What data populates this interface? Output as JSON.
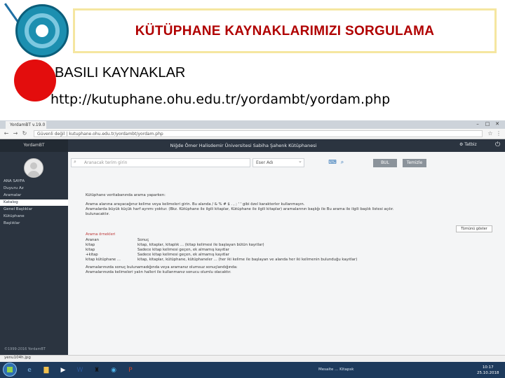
{
  "slide": {
    "title": "KÜTÜPHANE KAYNAKLARIMIZI SORGULAMA",
    "subtitle": "BASILI KAYNAKLAR",
    "url": "http://kutuphane.ohu.edu.tr/yordambt/yordam.php",
    "colors": {
      "title": "#b00000",
      "dot": "#e30d0d",
      "box": "#f5e6a0"
    }
  },
  "browser": {
    "tab_label": "YordamBT v.19.0",
    "address": "Güvenli değil | kutuphane.ohu.edu.tr/yordambt/yordam.php",
    "app_brand": "YordamBT",
    "app_title": "Niğde Ömer Halisdemir Üniversitesi Sabiha Şahenk Kütüphanesi",
    "settings_label": "Tatbiz",
    "sidebar": [
      "ANA SAYFA",
      "Duyuru Az",
      "Aramalar",
      "Katalog",
      "Genel Başlıklar",
      "Kütüphane",
      "Başlıklar"
    ],
    "copyright": "©1999-2016 YordamBT",
    "search": {
      "placeholder": "Aranacak terim girin",
      "field": "Eser Adı",
      "find_button": "BUL",
      "clear_button": "Temizle"
    },
    "help_lines": [
      "Kütüphane veritabanında arama yaparken:",
      "Arama alanına arayacağınız kelime veya kelimeleri girin. Bu alanda / & % # $ . , ; ' ' gibi özel karakterler kullanmayın.",
      "Aramalarda büyük küçük harf ayrımı yoktur. (Bkz. Kütüphane ile ilgili kitaplar, Kütüphane ile ilgili kitaplar) aramalarının başlığı ile Bu arama ile ilgili başlık listesi açılır.",
      "bulunacaktır."
    ],
    "examples_title": "Arama örnekleri",
    "examples": [
      {
        "term": "Aranan",
        "result": "Sonuç"
      },
      {
        "term": "kitap",
        "result": "kitap, kitaplar, kitaplık ... (kitap kelimesi ile başlayan bütün kayıtlar)"
      },
      {
        "term": "kitap",
        "result": "Sadece kitap kelimesi geçen, ek almamış kayıtlar"
      },
      {
        "term": "+kitap",
        "result": "Sadece kitap kelimesi geçen, ek almamış kayıtlar"
      },
      {
        "term": "kitap kütüphane ...",
        "result": "kitap, kitaplar, kütüphane, kütüphaneler ... (her iki kelime ile başlayan ve alanda her iki kelimenin bulunduğu kayıtlar)"
      }
    ],
    "footer_lines": [
      "Aramalarınızda sonuç bulunamadığında veya aramanız olumsuz sonuçlandığında:",
      "Aramalarınızda kelimeleri yalın halleri ile kullanmanız sonucu olumlu olacaktır."
    ],
    "status_button": "Tümünü göster",
    "download_item": "yenu104h.jpg",
    "tray_text": "Mesaite  ...  Kitapsk",
    "clock_time": "10:17",
    "clock_date": "25.10.2018"
  }
}
